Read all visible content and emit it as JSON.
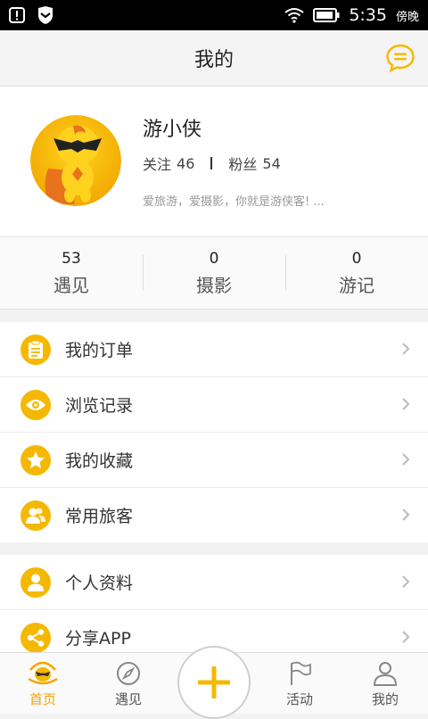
{
  "status_bar": {
    "time": "5:35",
    "ampm": "傍晚"
  },
  "header": {
    "title": "我的"
  },
  "profile": {
    "username": "游小侠",
    "follow_label": "关注",
    "follow_count": "46",
    "fans_label": "粉丝",
    "fans_count": "54",
    "bio": "爱旅游，爱摄影，你就是游侠客! ..."
  },
  "stats": [
    {
      "num": "53",
      "label": "遇见"
    },
    {
      "num": "0",
      "label": "摄影"
    },
    {
      "num": "0",
      "label": "游记"
    }
  ],
  "menu_group1": [
    {
      "label": "我的订单",
      "icon": "clipboard-icon"
    },
    {
      "label": "浏览记录",
      "icon": "eye-icon"
    },
    {
      "label": "我的收藏",
      "icon": "star-icon"
    },
    {
      "label": "常用旅客",
      "icon": "users-icon"
    }
  ],
  "menu_group2": [
    {
      "label": "个人资料",
      "icon": "person-icon"
    },
    {
      "label": "分享APP",
      "icon": "share-icon"
    }
  ],
  "tabs": [
    {
      "label": "首页",
      "icon": "home-icon",
      "active": true
    },
    {
      "label": "遇见",
      "icon": "compass-icon"
    },
    {
      "label": "活动",
      "icon": "flag-icon"
    },
    {
      "label": "我的",
      "icon": "user-icon"
    }
  ],
  "colors": {
    "accent": "#f5b800",
    "active_tab": "#f5a400"
  }
}
